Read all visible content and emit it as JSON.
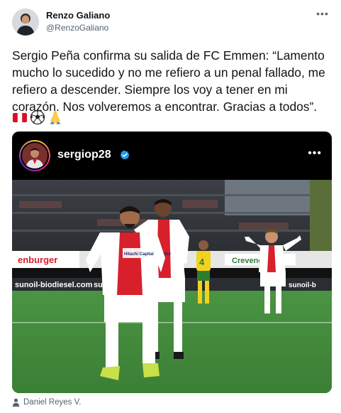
{
  "author": {
    "name": "Renzo Galiano",
    "handle": "@RenzoGaliano",
    "avatar_icon": "profile-photo"
  },
  "more_icon": "more-horizontal-icon",
  "more_label": "•••",
  "tweet": {
    "text": "Sergio Peña confirma su salida de FC Emmen: “Lamento mucho lo sucedido y no me refiero a un penal fallado, me refiero a descender. Siempre los voy a tener en mi corazón. Nos volveremos a encontrar. Gracias a todos”.",
    "emojis": [
      "flag-peru",
      "soccer-ball",
      "folded-hands"
    ]
  },
  "media": {
    "instagram": {
      "username": "sergiop28",
      "verified": true,
      "more_label": "•••"
    },
    "photo": {
      "ad_boards": [
        "enburger",
        "sunoil-biodiesel.com",
        "sun",
        "Crevenge",
        "sunoil-b"
      ],
      "shirt_sponsor": "Hitachi Capital Mobility",
      "player_number": "4"
    }
  },
  "credit": {
    "icon": "person-icon",
    "label": "Daniel Reyes V."
  },
  "colors": {
    "text": "#0f1419",
    "secondary": "#536471",
    "verified_blue": "#1d9bf0",
    "emmen_red": "#d8202c",
    "pitch_green": "#3f8a3a"
  }
}
